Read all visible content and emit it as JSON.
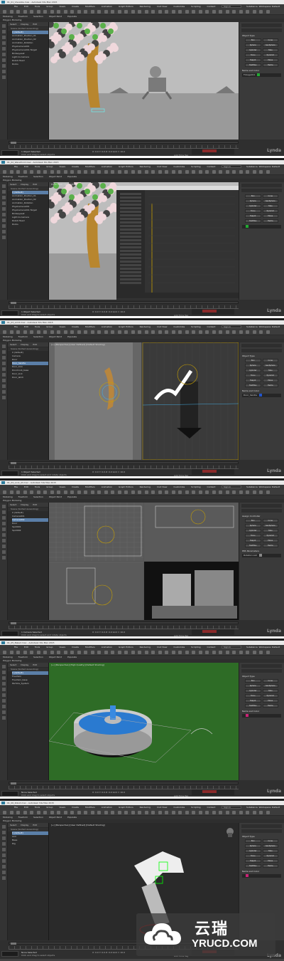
{
  "frames": [
    {
      "title": "01_01_Visualize.max - Autodesk 3ds Max 2015",
      "mode": "Modeling",
      "submode": "Polygon Modeling",
      "vp_label": "",
      "scene_items": [
        "Scene (Sorted Ascending)",
        "0 (default)",
        "Animation_Position_01",
        "Animation_Position_02",
        "Animation_Rotation",
        "PhysCamera001",
        "PhysCamera001.Target",
        "Birdseyeset",
        "Light.to.Camera",
        "Robot.Head",
        "Rocks"
      ],
      "selected_index": 1,
      "cmd_section": "Object Type",
      "name_color": "Name and Color",
      "object_name": "Foliage011",
      "status": "1 Object Selected",
      "prompt": "Click and drag to select objects",
      "swatch": "#22aa33"
    },
    {
      "title": "01_02_Wavefront.max - Autodesk 3ds Max 2015",
      "mode": "Modeling",
      "submode": "Polygon Modeling",
      "vp_label": "Track View - Curve Editor",
      "scene_items": [
        "Scene (Sorted Ascending)",
        "0 (default)",
        "Animation_Position_01",
        "Animation_Position_02",
        "Animation_Rotation",
        "PhysCamera001",
        "PhysCamera001.Target",
        "Birdseyeset",
        "Light.to.Camera",
        "Robot.Head",
        "Rocks"
      ],
      "selected_index": 1,
      "cmd_section": "",
      "name_color": "",
      "object_name": "",
      "status": "1 Object Selected",
      "prompt": "Click and drag to select objects",
      "swatch": "#22aa33"
    },
    {
      "title": "01_03_Limit.max - Autodesk 3ds Max 2015",
      "mode": "Modeling",
      "submode": "Polygon Modeling",
      "vp_label": "[+] [Perspective] [User Defined] [Default Shading]",
      "scene_items": [
        "Scene (Sorted Ascending)",
        "0 (default)",
        "Camera",
        "Door",
        "Door_handle",
        "Door_trim",
        "Doorknob_base",
        "Door_lock",
        "Door_latch"
      ],
      "selected_index": 4,
      "cmd_section": "Object Type",
      "name_color": "Name and Color",
      "object_name": "Door_handle",
      "status": "1 Object Selected",
      "prompt": "Click and drag to select and rotate objects",
      "swatch": "#2255cc"
    },
    {
      "title": "01_04_Look_At.max - Autodesk 3ds Max 2015",
      "mode": "Modeling",
      "submode": "Polygon Modeling",
      "vp_label": "",
      "scene_items": [
        "Scene (Sorted Ascending)",
        "0 (default)",
        "Camera001",
        "Camera002",
        "Door",
        "Spot001",
        "Spot002"
      ],
      "selected_index": 3,
      "cmd_section": "Assign Controller",
      "name_color": "PRS Parameters",
      "object_name": "Rotation List",
      "status": "1 Camera Selected",
      "prompt": "Click and drag to select and rotate objects",
      "swatch": "#888888"
    },
    {
      "title": "01_05_Baked.max - Autodesk 3ds Max 2015",
      "mode": "Modeling",
      "submode": "Polygon Modeling",
      "vp_label": "[+] [Perspective] [High Quality] [Default Shading]",
      "scene_items": [
        "Scene (Sorted Ascending)",
        "0 (default)",
        "Fountain",
        "Fountain_base",
        "Particle_System"
      ],
      "selected_index": 1,
      "cmd_section": "Object Type",
      "name_color": "Name and Color",
      "object_name": "",
      "status": "None Selected",
      "prompt": "Click and drag to select objects",
      "swatch": "#cc2277"
    },
    {
      "title": "01_06_Robot.max - Autodesk 3ds Max 2015",
      "mode": "Modeling",
      "submode": "Polygon Modeling",
      "vp_label": "[+] [Perspective] [User Defined] [Default Shading]",
      "scene_items": [
        "Scene (Sorted Ascending)",
        "0 (default)",
        "Arm",
        "Base",
        "Rig"
      ],
      "selected_index": 1,
      "cmd_section": "Object Type",
      "name_color": "Name and Color",
      "object_name": "",
      "status": "None Selected",
      "prompt": "Click and drag to select objects",
      "swatch": "#cc2277"
    }
  ],
  "menu": [
    "File",
    "Edit",
    "Tools",
    "Group",
    "Views",
    "Create",
    "Modifiers",
    "Animation",
    "Graph Editors",
    "Rendering",
    "Civil View",
    "Customize",
    "Scripting",
    "Content",
    "Help",
    "Arnold",
    "Substance"
  ],
  "ribbon": [
    "Modeling",
    "Freeform",
    "Selection",
    "Object Paint",
    "Populate"
  ],
  "scene_tabs": [
    "Select",
    "Display",
    "Edit"
  ],
  "sign_in": "Sign In",
  "workspace": "Workspace: Default",
  "object_buttons": [
    "Box",
    "Cone",
    "Sphere",
    "GeoSphere",
    "Cylinder",
    "Tube",
    "Torus",
    "Pyramid",
    "Teapot",
    "Plane",
    "TextPlus",
    "Hedra"
  ],
  "coords": "X: 0.0  Y: 0.0  Z: 0.0   Grid = 10.0",
  "add_time_tag": "Add Time Tag",
  "default_label": "Default",
  "lynda": "Lynda",
  "watermark": {
    "cn": "云瑞",
    "en": "YRUCD.COM"
  }
}
